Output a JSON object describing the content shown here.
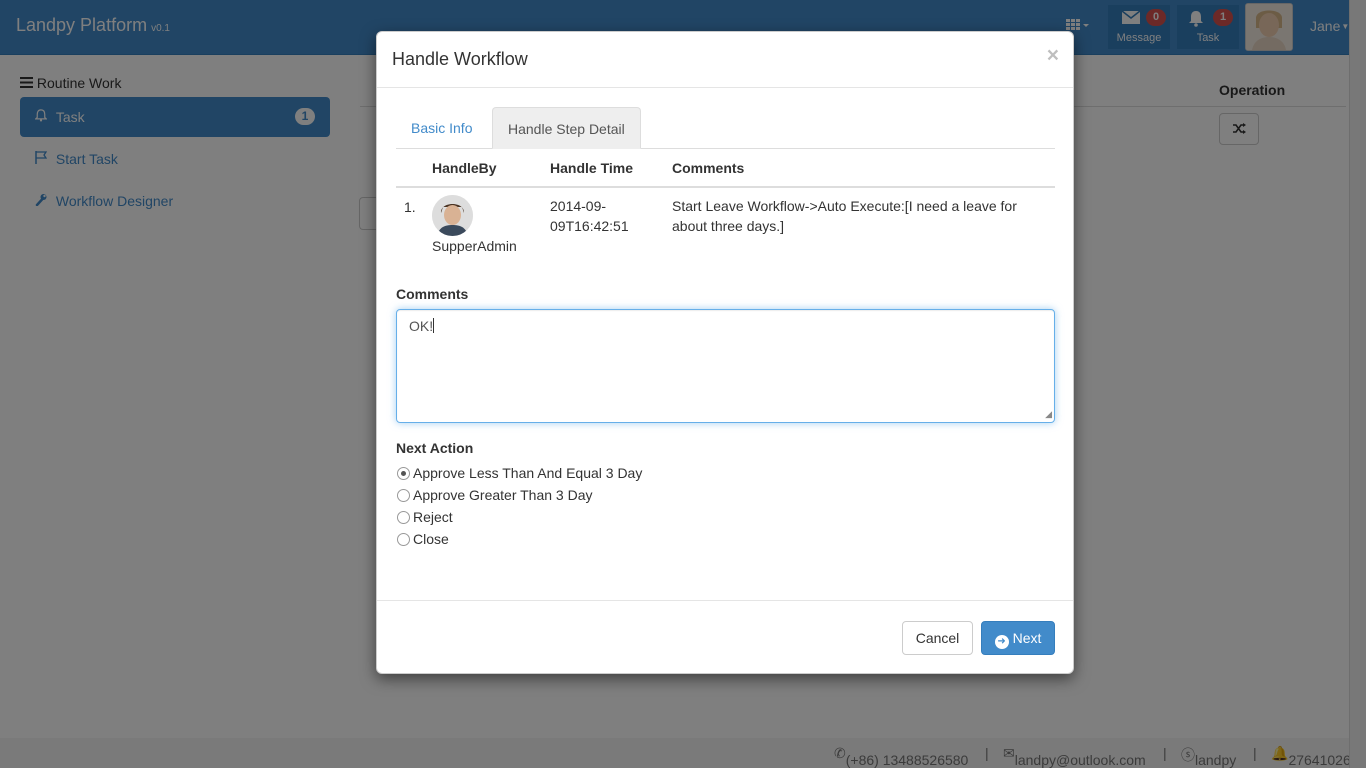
{
  "navbar": {
    "brand": "Landpy Platform",
    "version": "v0.1",
    "apps_icon": "grid-icon",
    "message": {
      "label": "Message",
      "count": "0",
      "icon": "envelope-icon"
    },
    "task": {
      "label": "Task",
      "count": "1",
      "icon": "bell-icon"
    },
    "user": "Jane"
  },
  "sidebar": {
    "heading": "Routine Work",
    "items": [
      {
        "label": "Task",
        "badge": "1",
        "icon": "bell-icon",
        "active": true
      },
      {
        "label": "Start Task",
        "icon": "flag-icon"
      },
      {
        "label": "Workflow Designer",
        "icon": "wrench-icon"
      }
    ]
  },
  "background": {
    "operation_header": "Operation",
    "operation_button_icon": "shuffle-icon"
  },
  "footer": {
    "phone": "(+86) 13488526580",
    "email": "landpy@outlook.com",
    "skype": "landpy",
    "qq": "27641026"
  },
  "modal": {
    "title": "Handle Workflow",
    "close": "×",
    "tabs": [
      {
        "label": "Basic Info"
      },
      {
        "label": "Handle Step Detail",
        "active": true
      }
    ],
    "table": {
      "headers": [
        "HandleBy",
        "Handle Time",
        "Comments"
      ],
      "rows": [
        {
          "index": "1.",
          "handler": "SupperAdmin",
          "time_line1": "2014-09-",
          "time_line2": "09T16:42:51",
          "comment_line1": "Start Leave Workflow->Auto Execute:[I need a leave for",
          "comment_line2": "about three days.]"
        }
      ]
    },
    "comments_label": "Comments",
    "comments_value": "OK!",
    "next_action_label": "Next Action",
    "actions": [
      {
        "label": "Approve Less Than And Equal 3 Day",
        "checked": true
      },
      {
        "label": "Approve Greater Than 3 Day"
      },
      {
        "label": "Reject"
      },
      {
        "label": "Close"
      }
    ],
    "cancel_label": "Cancel",
    "next_label": "Next"
  },
  "colors": {
    "primary": "#428bca",
    "badge_red": "#d9534f",
    "focus": "#66afe9"
  }
}
